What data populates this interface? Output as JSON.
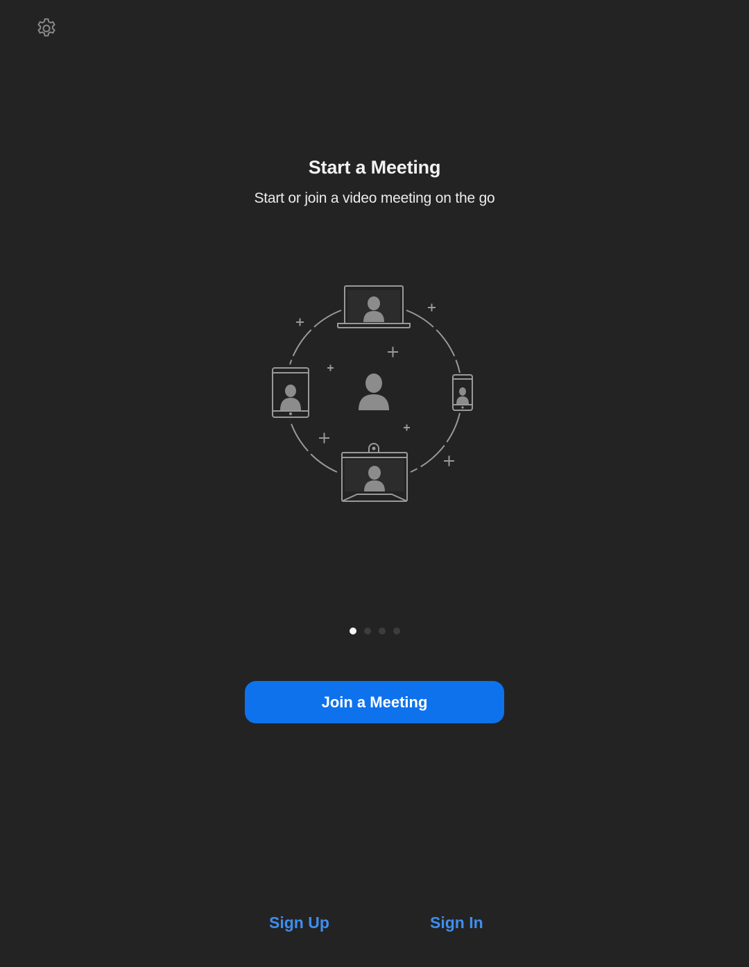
{
  "header": {
    "settings_icon": "gear-icon"
  },
  "onboarding": {
    "title": "Start a Meeting",
    "subtitle": "Start or join a video meeting on the go",
    "illustration": "meeting-devices-illustration",
    "page_count": 4,
    "current_page": 1
  },
  "actions": {
    "join_label": "Join a Meeting",
    "sign_up_label": "Sign Up",
    "sign_in_label": "Sign In"
  },
  "colors": {
    "background": "#232323",
    "primary_button": "#0e72ed",
    "link": "#3e8ef0"
  }
}
